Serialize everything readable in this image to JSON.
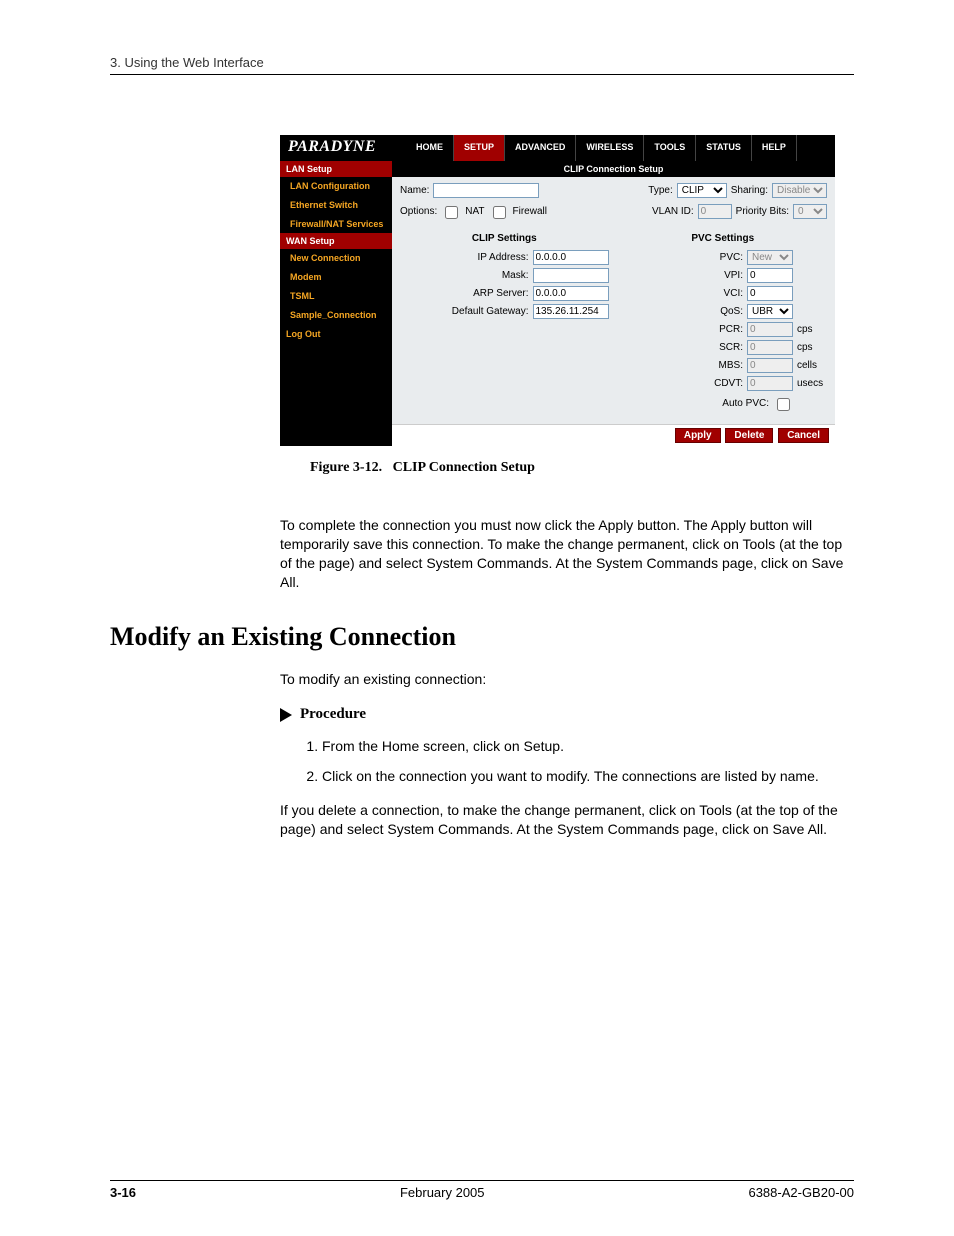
{
  "header": {
    "chapter": "3. Using the Web Interface"
  },
  "ui": {
    "logo": "PARADYNE",
    "nav": {
      "home": "HOME",
      "setup": "SETUP",
      "advanced": "ADVANCED",
      "wireless": "WIRELESS",
      "tools": "TOOLS",
      "status": "STATUS",
      "help": "HELP"
    },
    "sidebar": {
      "lan_head": "LAN Setup",
      "lan_conf": "LAN Configuration",
      "eth_switch": "Ethernet Switch",
      "firewall": "Firewall/NAT Services",
      "wan_head": "WAN Setup",
      "new_conn": "New Connection",
      "modem": "Modem",
      "tsml": "TSML",
      "sample": "Sample_Connection",
      "logout": "Log Out"
    },
    "title": "CLIP Connection Setup",
    "top": {
      "name_label": "Name:",
      "name_value": "",
      "type_label": "Type:",
      "type_value": "CLIP",
      "sharing_label": "Sharing:",
      "sharing_value": "Disable",
      "options_label": "Options:",
      "nat_label": "NAT",
      "fw_label": "Firewall",
      "vlan_label": "VLAN ID:",
      "vlan_value": "0",
      "pbits_label": "Priority Bits:",
      "pbits_value": "0"
    },
    "clip": {
      "head": "CLIP Settings",
      "ip_label": "IP Address:",
      "ip_value": "0.0.0.0",
      "mask_label": "Mask:",
      "mask_value": "",
      "arp_label": "ARP Server:",
      "arp_value": "0.0.0.0",
      "gw_label": "Default Gateway:",
      "gw_value": "135.26.11.254"
    },
    "pvc": {
      "head": "PVC Settings",
      "pvc_label": "PVC:",
      "pvc_value": "New",
      "vpi_label": "VPI:",
      "vpi_value": "0",
      "vci_label": "VCI:",
      "vci_value": "0",
      "qos_label": "QoS:",
      "qos_value": "UBR",
      "pcr_label": "PCR:",
      "pcr_value": "0",
      "pcr_unit": "cps",
      "scr_label": "SCR:",
      "scr_value": "0",
      "scr_unit": "cps",
      "mbs_label": "MBS:",
      "mbs_value": "0",
      "mbs_unit": "cells",
      "cdvt_label": "CDVT:",
      "cdvt_value": "0",
      "cdvt_unit": "usecs",
      "auto_label": "Auto PVC:"
    },
    "buttons": {
      "apply": "Apply",
      "delete": "Delete",
      "cancel": "Cancel"
    }
  },
  "figure": {
    "num": "Figure 3-12.",
    "title": "CLIP Connection Setup"
  },
  "para1": "To complete the connection you must now click the Apply button. The Apply button will temporarily save this connection. To make the change permanent, click on Tools (at the top of the page) and select System Commands. At the System Commands page, click on Save All.",
  "heading": "Modify an Existing Connection",
  "para2": "To modify an existing connection:",
  "procedure_label": "Procedure",
  "steps": {
    "s1": "From the Home screen, click on Setup.",
    "s2": "Click on the connection you want to modify. The connections are listed by name."
  },
  "para3": "If you delete a connection, to make the change permanent, click on Tools (at the top of the page) and select System Commands. At the System Commands page, click on Save All.",
  "footer": {
    "page": "3-16",
    "date": "February 2005",
    "doc": "6388-A2-GB20-00"
  }
}
